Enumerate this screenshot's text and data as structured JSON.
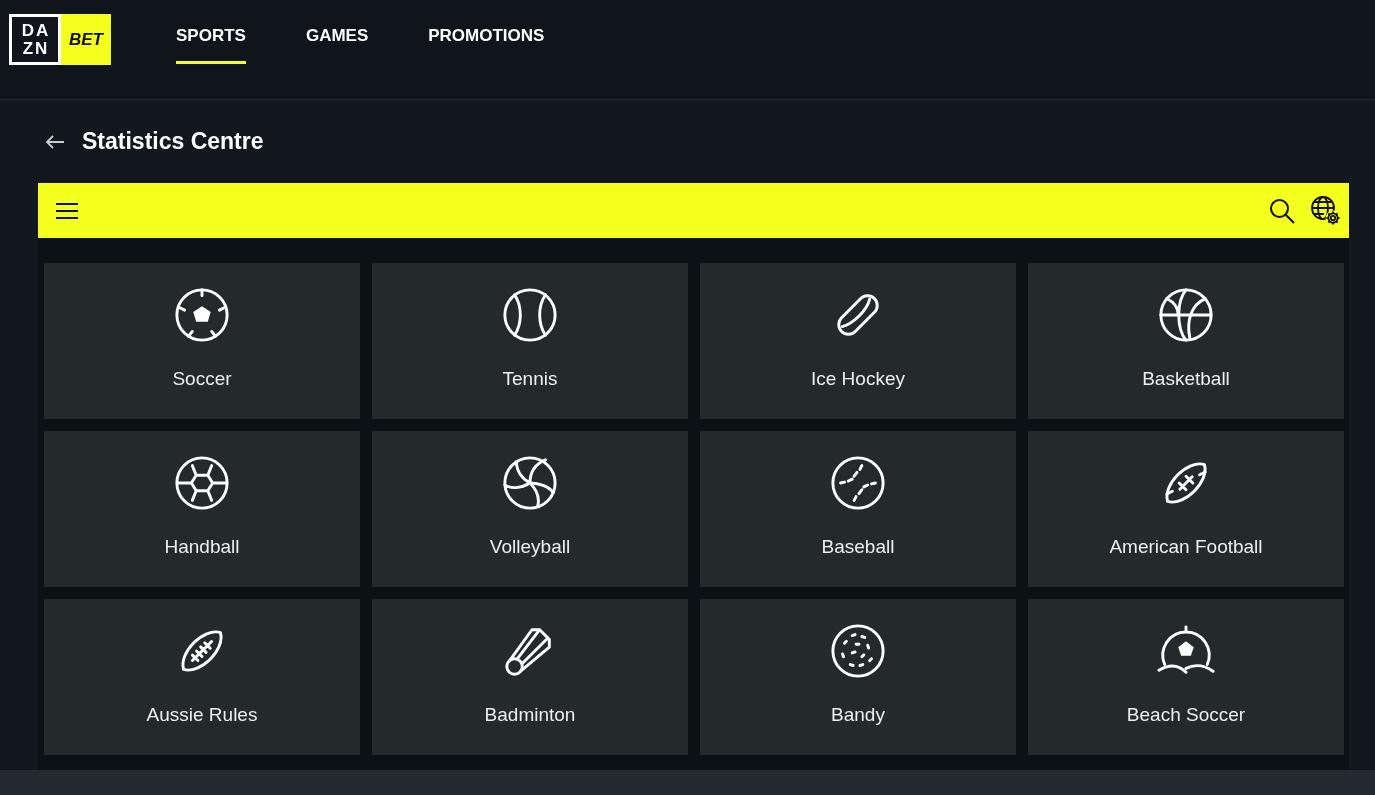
{
  "logo": {
    "brand_top": "DA",
    "brand_bottom": "ZN",
    "badge": "BET"
  },
  "nav": [
    {
      "label": "SPORTS",
      "selected": true
    },
    {
      "label": "GAMES",
      "selected": false
    },
    {
      "label": "PROMOTIONS",
      "selected": false
    }
  ],
  "page": {
    "title": "Statistics Centre"
  },
  "sports": [
    {
      "name": "Soccer",
      "kind": "soccer"
    },
    {
      "name": "Tennis",
      "kind": "tennis"
    },
    {
      "name": "Ice Hockey",
      "kind": "puck"
    },
    {
      "name": "Basketball",
      "kind": "basketball"
    },
    {
      "name": "Handball",
      "kind": "handball"
    },
    {
      "name": "Volleyball",
      "kind": "volleyball"
    },
    {
      "name": "Baseball",
      "kind": "baseball"
    },
    {
      "name": "American Football",
      "kind": "football"
    },
    {
      "name": "Aussie Rules",
      "kind": "aussie"
    },
    {
      "name": "Badminton",
      "kind": "shuttlecock"
    },
    {
      "name": "Bandy",
      "kind": "bandy"
    },
    {
      "name": "Beach Soccer",
      "kind": "beach"
    }
  ]
}
